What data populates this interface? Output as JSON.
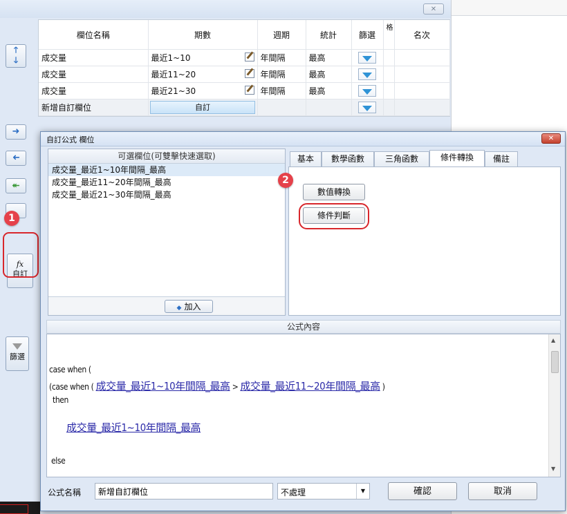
{
  "grid": {
    "headers": [
      "欄位名稱",
      "期數",
      "週期",
      "統計",
      "篩選",
      "格",
      "名次"
    ],
    "rows": [
      {
        "name": "成交量",
        "period": "最近1~10",
        "cycle": "年間隔",
        "stat": "最高"
      },
      {
        "name": "成交量",
        "period": "最近11~20",
        "cycle": "年間隔",
        "stat": "最高"
      },
      {
        "name": "成交量",
        "period": "最近21~30",
        "cycle": "年間隔",
        "stat": "最高"
      }
    ],
    "new_row": {
      "name": "新增自訂欄位",
      "custom_label": "自訂"
    }
  },
  "toolbar": {
    "fx_symbol": "fx",
    "custom_label": "自訂",
    "filter_label": "篩選"
  },
  "badges": {
    "one": "1",
    "two": "2"
  },
  "dialog": {
    "title": "自訂公式 欄位",
    "close_symbol": "✕",
    "available_header": "可選欄位(可雙擊快速選取)",
    "available_items": [
      "成交量_最近1~10年間隔_最高",
      "成交量_最近11~20年間隔_最高",
      "成交量_最近21~30年間隔_最高"
    ],
    "add_label": "加入",
    "tabs": [
      "基本",
      "數學函數",
      "三角函數",
      "條件轉換",
      "備註"
    ],
    "active_tab": "條件轉換",
    "btn_value_convert": "數值轉換",
    "btn_condition": "條件判斷",
    "formula_header": "公式內容",
    "formula": {
      "line1": "case when (",
      "line2_prefix": "(case when (",
      "line2_a": "成交量_最近1~10年間隔_最高",
      "line2_op": ">",
      "line2_b": "成交量_最近11~20年間隔_最高",
      "line2_suffix": ")",
      "line3": "then",
      "line4": "成交量_最近1~10年間隔_最高",
      "line5": "else"
    },
    "formula_name_label": "公式名稱",
    "formula_name_value": "新增自訂欄位",
    "select_value": "不處理",
    "confirm_label": "確認",
    "cancel_label": "取消"
  },
  "colors": {
    "accent": "#2d6fc4",
    "highlight": "#d8262b",
    "link": "#2b2aa8"
  }
}
